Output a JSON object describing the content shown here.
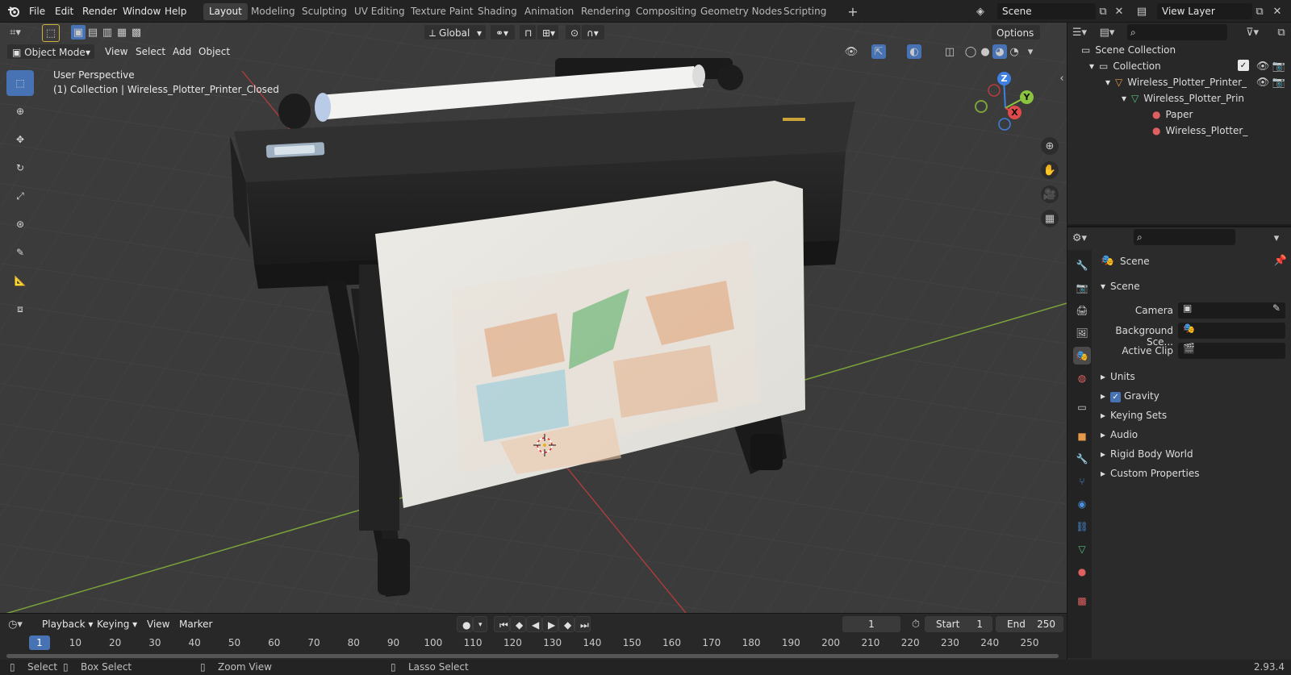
{
  "topbar": {
    "menus": [
      "File",
      "Edit",
      "Render",
      "Window",
      "Help"
    ],
    "workspaces": [
      "Layout",
      "Modeling",
      "Sculpting",
      "UV Editing",
      "Texture Paint",
      "Shading",
      "Animation",
      "Rendering",
      "Compositing",
      "Geometry Nodes",
      "Scripting"
    ],
    "active_workspace": "Layout",
    "scene": "Scene",
    "view_layer": "View Layer"
  },
  "viewport_header": {
    "orientation": "Global",
    "options": "Options",
    "mode": "Object Mode",
    "menus": [
      "View",
      "Select",
      "Add",
      "Object"
    ]
  },
  "viewport": {
    "view_name": "User Perspective",
    "collection_info": "(1) Collection | Wireless_Plotter_Printer_Closed",
    "gizmo_axes": {
      "x": "X",
      "y": "Y",
      "z": "Z"
    }
  },
  "outliner": {
    "rows": [
      {
        "label": "Scene Collection",
        "icon": "collection-icon"
      },
      {
        "label": "Collection",
        "icon": "collection-icon"
      },
      {
        "label": "Wireless_Plotter_Printer_",
        "icon": "object-icon"
      },
      {
        "label": "Wireless_Plotter_Prin",
        "icon": "mesh-icon"
      },
      {
        "label": "Paper",
        "icon": "material-icon"
      },
      {
        "label": "Wireless_Plotter_",
        "icon": "material-icon"
      }
    ]
  },
  "properties": {
    "header": "Scene",
    "panel_title": "Scene",
    "fields": [
      {
        "label": "Camera"
      },
      {
        "label": "Background Sce..."
      },
      {
        "label": "Active Clip"
      }
    ],
    "sections": [
      {
        "label": "Units",
        "checkbox": false
      },
      {
        "label": "Gravity",
        "checkbox": true
      },
      {
        "label": "Keying Sets",
        "checkbox": false
      },
      {
        "label": "Audio",
        "checkbox": false
      },
      {
        "label": "Rigid Body World",
        "checkbox": false
      },
      {
        "label": "Custom Properties",
        "checkbox": false
      }
    ]
  },
  "timeline": {
    "menus": [
      "Playback",
      "Keying",
      "View",
      "Marker"
    ],
    "current_frame": "1",
    "start_label": "Start",
    "start": "1",
    "end_label": "End",
    "end": "250",
    "ticks": [
      "1",
      "10",
      "20",
      "30",
      "40",
      "50",
      "60",
      "70",
      "80",
      "90",
      "100",
      "110",
      "120",
      "130",
      "140",
      "150",
      "160",
      "170",
      "180",
      "190",
      "200",
      "210",
      "220",
      "230",
      "240",
      "250"
    ]
  },
  "statusbar": {
    "items": [
      "Select",
      "Box Select",
      "Zoom View",
      "Lasso Select"
    ],
    "version": "2.93.4"
  },
  "colors": {
    "accent": "#4772b3",
    "axis_x": "#e04a4a",
    "axis_y": "#8ac440",
    "axis_z": "#3f7fe0",
    "grid_y_line": "#7aa33a",
    "grid_x_line": "#b83c3c"
  }
}
